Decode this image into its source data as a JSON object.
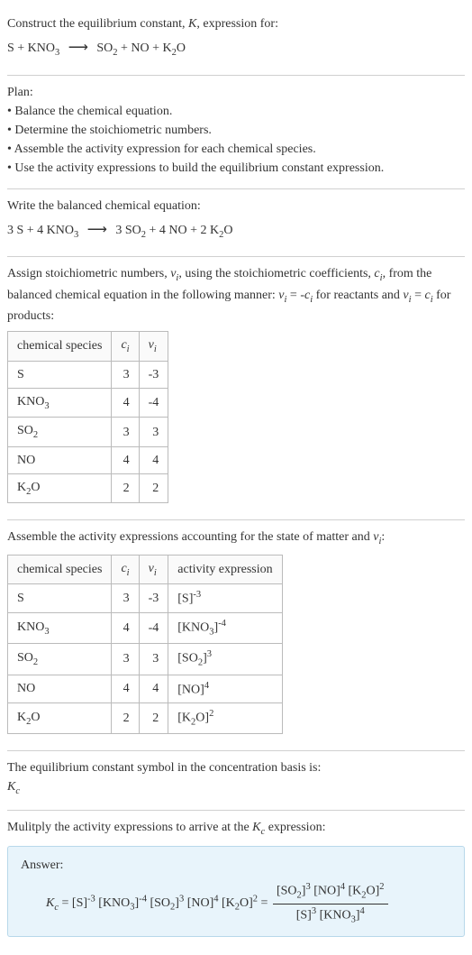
{
  "prompt": {
    "line1": "Construct the equilibrium constant, K, expression for:",
    "reaction_text": "S + KNO₃ ⟶ SO₂ + NO + K₂O"
  },
  "plan": {
    "heading": "Plan:",
    "items": [
      "Balance the chemical equation.",
      "Determine the stoichiometric numbers.",
      "Assemble the activity expression for each chemical species.",
      "Use the activity expressions to build the equilibrium constant expression."
    ]
  },
  "balanced": {
    "heading": "Write the balanced chemical equation:",
    "equation": "3 S + 4 KNO₃ ⟶ 3 SO₂ + 4 NO + 2 K₂O"
  },
  "stoich": {
    "intro_a": "Assign stoichiometric numbers, νᵢ, using the stoichiometric coefficients, cᵢ, from the balanced chemical equation in the following manner: νᵢ = -cᵢ for reactants and νᵢ = cᵢ for products:",
    "headers": [
      "chemical species",
      "cᵢ",
      "νᵢ"
    ],
    "rows": [
      {
        "species": "S",
        "c": "3",
        "nu": "-3"
      },
      {
        "species": "KNO₃",
        "c": "4",
        "nu": "-4"
      },
      {
        "species": "SO₂",
        "c": "3",
        "nu": "3"
      },
      {
        "species": "NO",
        "c": "4",
        "nu": "4"
      },
      {
        "species": "K₂O",
        "c": "2",
        "nu": "2"
      }
    ]
  },
  "activity": {
    "intro": "Assemble the activity expressions accounting for the state of matter and νᵢ:",
    "headers": [
      "chemical species",
      "cᵢ",
      "νᵢ",
      "activity expression"
    ],
    "rows": [
      {
        "species": "S",
        "c": "3",
        "nu": "-3",
        "act": "[S]⁻³"
      },
      {
        "species": "KNO₃",
        "c": "4",
        "nu": "-4",
        "act": "[KNO₃]⁻⁴"
      },
      {
        "species": "SO₂",
        "c": "3",
        "nu": "3",
        "act": "[SO₂]³"
      },
      {
        "species": "NO",
        "c": "4",
        "nu": "4",
        "act": "[NO]⁴"
      },
      {
        "species": "K₂O",
        "c": "2",
        "nu": "2",
        "act": "[K₂O]²"
      }
    ]
  },
  "kc_symbol": {
    "line1": "The equilibrium constant symbol in the concentration basis is:",
    "symbol": "K꜀"
  },
  "multiply": {
    "line": "Mulitply the activity expressions to arrive at the K꜀ expression:"
  },
  "answer": {
    "label": "Answer:",
    "lhs": "K꜀ = [S]⁻³ [KNO₃]⁻⁴ [SO₂]³ [NO]⁴ [K₂O]² = ",
    "frac_num": "[SO₂]³ [NO]⁴ [K₂O]²",
    "frac_den": "[S]³ [KNO₃]⁴"
  },
  "chart_data": {
    "type": "table",
    "tables": [
      {
        "title": "stoichiometric numbers",
        "columns": [
          "chemical species",
          "c_i",
          "nu_i"
        ],
        "rows": [
          [
            "S",
            3,
            -3
          ],
          [
            "KNO3",
            4,
            -4
          ],
          [
            "SO2",
            3,
            3
          ],
          [
            "NO",
            4,
            4
          ],
          [
            "K2O",
            2,
            2
          ]
        ]
      },
      {
        "title": "activity expressions",
        "columns": [
          "chemical species",
          "c_i",
          "nu_i",
          "activity expression"
        ],
        "rows": [
          [
            "S",
            3,
            -3,
            "[S]^-3"
          ],
          [
            "KNO3",
            4,
            -4,
            "[KNO3]^-4"
          ],
          [
            "SO2",
            3,
            3,
            "[SO2]^3"
          ],
          [
            "NO",
            4,
            4,
            "[NO]^4"
          ],
          [
            "K2O",
            2,
            2,
            "[K2O]^2"
          ]
        ]
      }
    ]
  }
}
